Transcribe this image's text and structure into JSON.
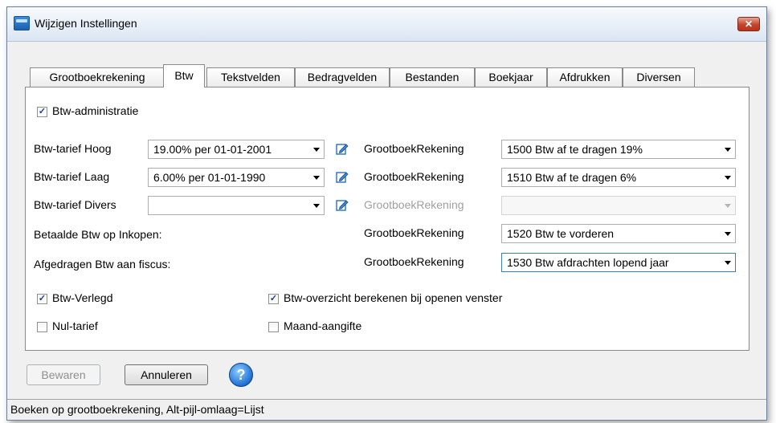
{
  "window": {
    "title": "Wijzigen Instellingen",
    "close_glyph": "✕"
  },
  "tabs": [
    {
      "label": "Grootboekrekening",
      "active": false
    },
    {
      "label": "Btw",
      "active": true
    },
    {
      "label": "Tekstvelden",
      "active": false
    },
    {
      "label": "Bedragvelden",
      "active": false
    },
    {
      "label": "Bestanden",
      "active": false
    },
    {
      "label": "Boekjaar",
      "active": false
    },
    {
      "label": "Afdrukken",
      "active": false
    },
    {
      "label": "Diversen",
      "active": false
    }
  ],
  "btw": {
    "administratie": {
      "label": "Btw-administratie",
      "checked": true
    },
    "rows": [
      {
        "label": "Btw-tarief Hoog",
        "tarief": "19.00% per 01-01-2001",
        "gb_label": "GrootboekRekening",
        "gb_value": "1500 Btw af te dragen 19%",
        "enabled": true
      },
      {
        "label": "Btw-tarief Laag",
        "tarief": "6.00% per 01-01-1990",
        "gb_label": "GrootboekRekening",
        "gb_value": "1510 Btw af te dragen 6%",
        "enabled": true
      },
      {
        "label": "Btw-tarief Divers",
        "tarief": "",
        "gb_label": "GrootboekRekening",
        "gb_value": "",
        "enabled": false
      }
    ],
    "inkopen": {
      "label": "Betaalde Btw op Inkopen:",
      "gb_label": "GrootboekRekening",
      "gb_value": "1520 Btw te vorderen"
    },
    "fiscus": {
      "label": "Afgedragen Btw aan fiscus:",
      "gb_label": "GrootboekRekening",
      "gb_value": "1530 Btw afdrachten lopend jaar"
    },
    "verlegd": {
      "label": "Btw-Verlegd",
      "checked": true
    },
    "nul_tarief": {
      "label": "Nul-tarief",
      "checked": false
    },
    "overzicht": {
      "label": "Btw-overzicht berekenen bij openen venster",
      "checked": true
    },
    "maand": {
      "label": "Maand-aangifte",
      "checked": false
    }
  },
  "buttons": {
    "bewaren": "Bewaren",
    "annuleren": "Annuleren",
    "help": "?"
  },
  "status": "Boeken op grootboekrekening, Alt-pijl-omlaag=Lijst",
  "colors": {
    "accent": "#1f6fd6",
    "close": "#c4432b"
  }
}
